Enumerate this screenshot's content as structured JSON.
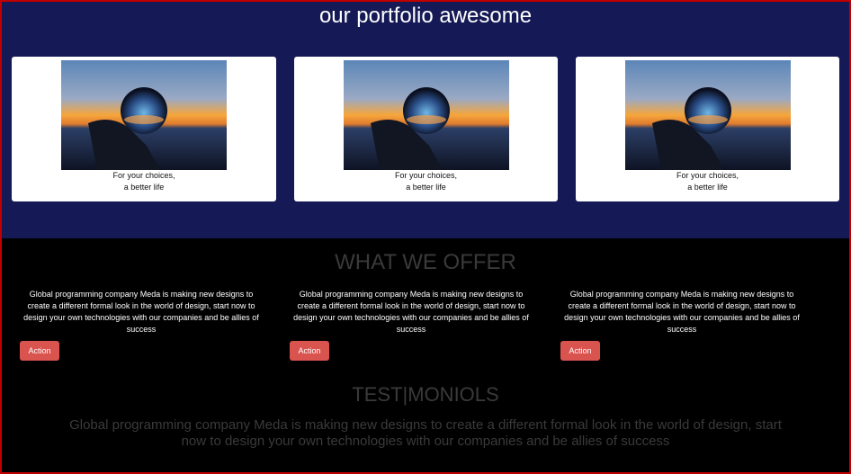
{
  "portfolio": {
    "title": "our portfolio awesome",
    "cards": [
      {
        "caption_line1": "For your choices,",
        "caption_line2": "a better life"
      },
      {
        "caption_line1": "For your choices,",
        "caption_line2": "a better life"
      },
      {
        "caption_line1": "For your choices,",
        "caption_line2": "a better life"
      }
    ]
  },
  "offer": {
    "title": "WHAT WE OFFER",
    "columns": [
      {
        "text": "Global programming company Meda is making new designs to create a different formal look in the world of design, start now to design your own technologies with our companies and be allies of success",
        "button": "Action"
      },
      {
        "text": "Global programming company Meda is making new designs to create a different formal look in the world of design, start now to design your own technologies with our companies and be allies of success",
        "button": "Action"
      },
      {
        "text": "Global programming company Meda is making new designs to create a different formal look in the world of design, start now to design your own technologies with our companies and be allies of success",
        "button": "Action"
      }
    ]
  },
  "testimonials": {
    "title": "TEST|MONIOLS",
    "text": "Global programming company Meda is making new designs to create a different formal look in the world of design, start now to design your own technologies with our companies and be allies of success"
  },
  "colors": {
    "portfolio_bg": "#151a56",
    "page_bg": "#000000",
    "button_bg": "#d9534f",
    "border": "#c00000",
    "muted_heading": "#3a3a3a"
  },
  "icons": {
    "photo": "crystal-ball-sunset-image"
  }
}
